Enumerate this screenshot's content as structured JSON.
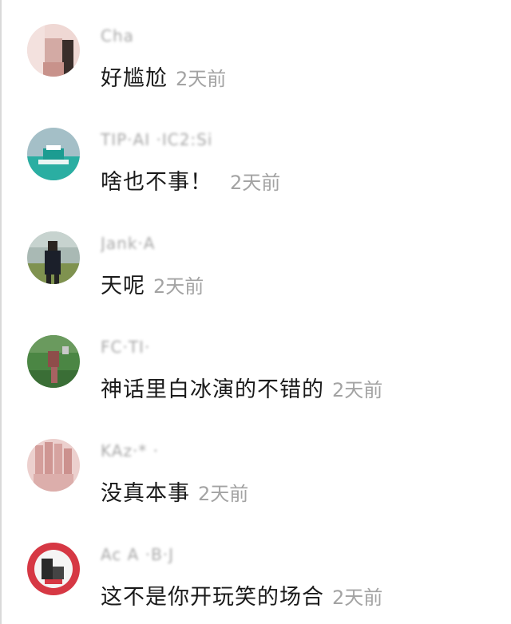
{
  "comments": [
    {
      "username": "Cha",
      "text": "好尴尬",
      "time": "2天前",
      "avatar_icon": "avatar-person-pink",
      "avatar_colors": [
        "#f1d7d3",
        "#c9a59f",
        "#3a2e2b"
      ]
    },
    {
      "username": "TIP·AI ·IC2:Si",
      "text": "啥也不事！",
      "time": "2天前",
      "avatar_icon": "avatar-teal-bag",
      "avatar_colors": [
        "#9ab6c0",
        "#1aa59a",
        "#ffffff"
      ]
    },
    {
      "username": "Jank·A",
      "text": "天呢",
      "time": "2天前",
      "avatar_icon": "avatar-person-outdoor",
      "avatar_colors": [
        "#8fa7a6",
        "#1b1f2a",
        "#7d8f4e"
      ]
    },
    {
      "username": "FC·TI·",
      "text": "神话里白冰演的不错的",
      "time": "2天前",
      "avatar_icon": "avatar-green-field",
      "avatar_colors": [
        "#3f7a3a",
        "#8a4a4a",
        "#6aa36a"
      ]
    },
    {
      "username": "KAz·* ·",
      "text": "没真本事",
      "time": "2天前",
      "avatar_icon": "avatar-hand-pink",
      "avatar_colors": [
        "#e7c4c2",
        "#cf9896",
        "#f4e2e0"
      ]
    },
    {
      "username": "Ac A ·B·J",
      "text": "这不是你开玩笑的场合",
      "time": "2天前",
      "avatar_icon": "avatar-red-white-badge",
      "avatar_colors": [
        "#d33a44",
        "#f4f4f4",
        "#2a2a2a"
      ]
    }
  ]
}
